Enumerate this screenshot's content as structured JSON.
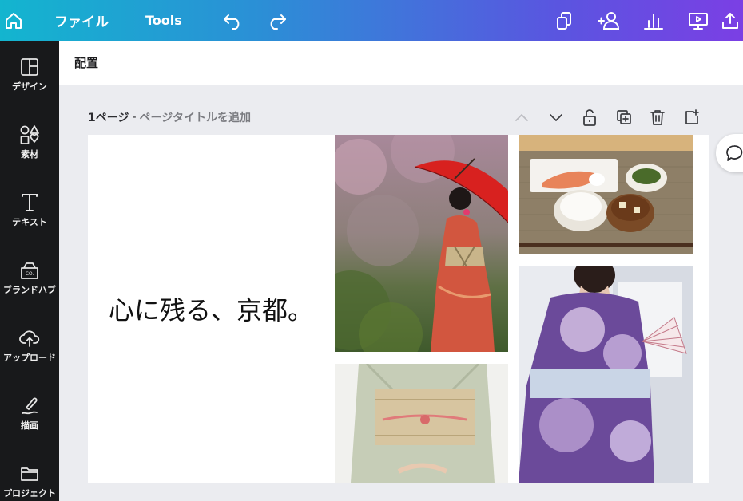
{
  "topbar": {
    "file_label": "ファイル",
    "tools_label": "Tools",
    "icons": [
      "home-icon",
      "undo-icon",
      "redo-icon",
      "copy-pages-icon",
      "share-people-icon",
      "insights-chart-icon",
      "present-icon",
      "upload-share-icon"
    ]
  },
  "sidebar": {
    "items": [
      {
        "label": "デザイン",
        "icon": "layout-icon"
      },
      {
        "label": "素材",
        "icon": "elements-icon"
      },
      {
        "label": "テキスト",
        "icon": "text-icon"
      },
      {
        "label": "ブランドハブ",
        "icon": "brand-hub-icon"
      },
      {
        "label": "アップロード",
        "icon": "cloud-upload-icon"
      },
      {
        "label": "描画",
        "icon": "draw-icon"
      },
      {
        "label": "プロジェクト",
        "icon": "folder-icon"
      }
    ]
  },
  "arrange": {
    "label": "配置"
  },
  "page": {
    "number_label": "1ページ",
    "separator": "-",
    "title_placeholder": "ページタイトルを追加",
    "tool_icons": [
      "chevron-up-icon",
      "chevron-down-icon",
      "lock-icon",
      "duplicate-icon",
      "trash-icon",
      "add-page-icon"
    ]
  },
  "canvas": {
    "headline": "心に残る、京都。",
    "photos": [
      "kimono-umbrella-photo",
      "japanese-breakfast-photo",
      "obi-kimono-photo",
      "yukata-fan-photo"
    ]
  },
  "colors": {
    "topbar_start": "#13b5cf",
    "topbar_end": "#7b3fe4",
    "sidebar_bg": "#18191b",
    "workspace_bg": "#ebecf0"
  }
}
